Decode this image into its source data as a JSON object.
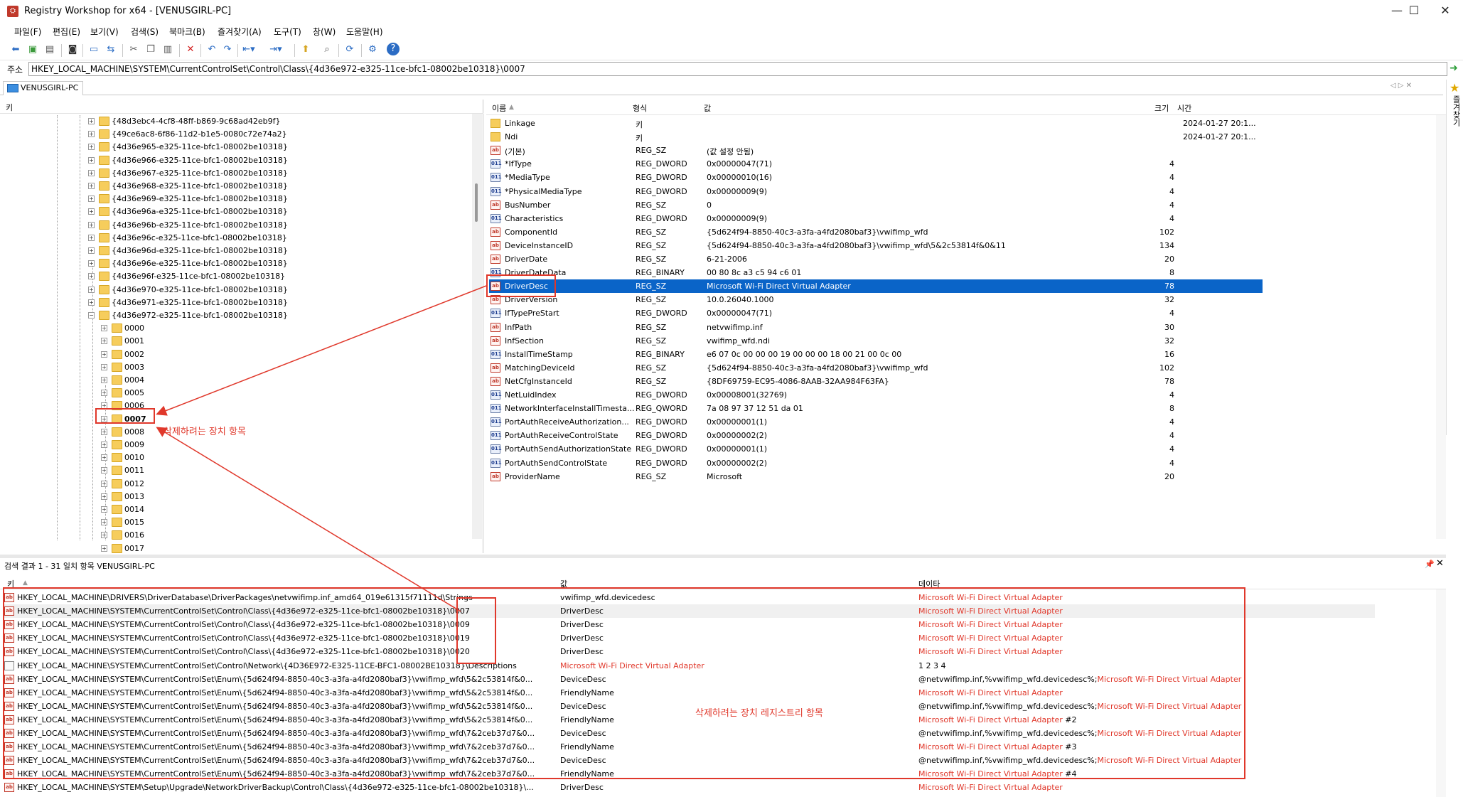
{
  "window": {
    "title": "Registry Workshop for x64 - [VENUSGIRL-PC]",
    "controls": [
      "—",
      "☐",
      "✕"
    ]
  },
  "menu": [
    "파일(F)",
    "편집(E)",
    "보기(V)",
    "검색(S)",
    "북마크(B)",
    "즐겨찾기(A)",
    "도구(T)",
    "창(W)",
    "도움말(H)"
  ],
  "address": {
    "label": "주소",
    "value": "HKEY_LOCAL_MACHINE\\SYSTEM\\CurrentControlSet\\Control\\Class\\{4d36e972-e325-11ce-bfc1-08002be10318}\\0007"
  },
  "computer_tab": "VENUSGIRL-PC",
  "favorites_label": "즐겨찾기",
  "tree": {
    "header": "키",
    "class_keys": [
      "{48d3ebc4-4cf8-48ff-b869-9c68ad42eb9f}",
      "{49ce6ac8-6f86-11d2-b1e5-0080c72e74a2}",
      "{4d36e965-e325-11ce-bfc1-08002be10318}",
      "{4d36e966-e325-11ce-bfc1-08002be10318}",
      "{4d36e967-e325-11ce-bfc1-08002be10318}",
      "{4d36e968-e325-11ce-bfc1-08002be10318}",
      "{4d36e969-e325-11ce-bfc1-08002be10318}",
      "{4d36e96a-e325-11ce-bfc1-08002be10318}",
      "{4d36e96b-e325-11ce-bfc1-08002be10318}",
      "{4d36e96c-e325-11ce-bfc1-08002be10318}",
      "{4d36e96d-e325-11ce-bfc1-08002be10318}",
      "{4d36e96e-e325-11ce-bfc1-08002be10318}",
      "{4d36e96f-e325-11ce-bfc1-08002be10318}",
      "{4d36e970-e325-11ce-bfc1-08002be10318}",
      "{4d36e971-e325-11ce-bfc1-08002be10318}",
      "{4d36e972-e325-11ce-bfc1-08002be10318}"
    ],
    "sub_keys": [
      "0000",
      "0001",
      "0002",
      "0003",
      "0004",
      "0005",
      "0006",
      "0007",
      "0008",
      "0009",
      "0010",
      "0011",
      "0012",
      "0013",
      "0014",
      "0015",
      "0016",
      "0017"
    ],
    "selected_sub_key": "0007"
  },
  "values": {
    "headers": {
      "name": "이름",
      "type": "형식",
      "value": "값",
      "size": "크기",
      "time": "시간"
    },
    "rows": [
      {
        "icon": "folder",
        "name": "Linkage",
        "type": "키",
        "value": "",
        "size": "",
        "time": "2024-01-27 20:1..."
      },
      {
        "icon": "folder",
        "name": "Ndi",
        "type": "키",
        "value": "",
        "size": "",
        "time": "2024-01-27 20:1..."
      },
      {
        "icon": "sz",
        "name": "(기본)",
        "type": "REG_SZ",
        "value": "(값 설정 안됨)",
        "size": "",
        "time": ""
      },
      {
        "icon": "bin",
        "name": "*IfType",
        "type": "REG_DWORD",
        "value": "0x00000047(71)",
        "size": "4",
        "time": ""
      },
      {
        "icon": "bin",
        "name": "*MediaType",
        "type": "REG_DWORD",
        "value": "0x00000010(16)",
        "size": "4",
        "time": ""
      },
      {
        "icon": "bin",
        "name": "*PhysicalMediaType",
        "type": "REG_DWORD",
        "value": "0x00000009(9)",
        "size": "4",
        "time": ""
      },
      {
        "icon": "sz",
        "name": "BusNumber",
        "type": "REG_SZ",
        "value": "0",
        "size": "4",
        "time": ""
      },
      {
        "icon": "bin",
        "name": "Characteristics",
        "type": "REG_DWORD",
        "value": "0x00000009(9)",
        "size": "4",
        "time": ""
      },
      {
        "icon": "sz",
        "name": "ComponentId",
        "type": "REG_SZ",
        "value": "{5d624f94-8850-40c3-a3fa-a4fd2080baf3}\\vwifimp_wfd",
        "size": "102",
        "time": ""
      },
      {
        "icon": "sz",
        "name": "DeviceInstanceID",
        "type": "REG_SZ",
        "value": "{5d624f94-8850-40c3-a3fa-a4fd2080baf3}\\vwifimp_wfd\\5&2c53814f&0&11",
        "size": "134",
        "time": ""
      },
      {
        "icon": "sz",
        "name": "DriverDate",
        "type": "REG_SZ",
        "value": "6-21-2006",
        "size": "20",
        "time": ""
      },
      {
        "icon": "bin",
        "name": "DriverDateData",
        "type": "REG_BINARY",
        "value": "00 80 8c a3 c5 94 c6 01",
        "size": "8",
        "time": ""
      },
      {
        "icon": "sz",
        "name": "DriverDesc",
        "type": "REG_SZ",
        "value": "Microsoft Wi-Fi Direct Virtual Adapter",
        "size": "78",
        "time": "",
        "selected": true
      },
      {
        "icon": "sz",
        "name": "DriverVersion",
        "type": "REG_SZ",
        "value": "10.0.26040.1000",
        "size": "32",
        "time": ""
      },
      {
        "icon": "bin",
        "name": "IfTypePreStart",
        "type": "REG_DWORD",
        "value": "0x00000047(71)",
        "size": "4",
        "time": ""
      },
      {
        "icon": "sz",
        "name": "InfPath",
        "type": "REG_SZ",
        "value": "netvwifimp.inf",
        "size": "30",
        "time": ""
      },
      {
        "icon": "sz",
        "name": "InfSection",
        "type": "REG_SZ",
        "value": "vwifimp_wfd.ndi",
        "size": "32",
        "time": ""
      },
      {
        "icon": "bin",
        "name": "InstallTimeStamp",
        "type": "REG_BINARY",
        "value": "e6 07 0c 00 00 00 19 00 00 00 18 00 21 00 0c 00",
        "size": "16",
        "time": ""
      },
      {
        "icon": "sz",
        "name": "MatchingDeviceId",
        "type": "REG_SZ",
        "value": "{5d624f94-8850-40c3-a3fa-a4fd2080baf3}\\vwifimp_wfd",
        "size": "102",
        "time": ""
      },
      {
        "icon": "sz",
        "name": "NetCfgInstanceId",
        "type": "REG_SZ",
        "value": "{8DF69759-EC95-4086-8AAB-32AA984F63FA}",
        "size": "78",
        "time": ""
      },
      {
        "icon": "bin",
        "name": "NetLuidIndex",
        "type": "REG_DWORD",
        "value": "0x00008001(32769)",
        "size": "4",
        "time": ""
      },
      {
        "icon": "bin",
        "name": "NetworkInterfaceInstallTimesta...",
        "type": "REG_QWORD",
        "value": "7a 08 97 37 12 51 da 01",
        "size": "8",
        "time": ""
      },
      {
        "icon": "bin",
        "name": "PortAuthReceiveAuthorization...",
        "type": "REG_DWORD",
        "value": "0x00000001(1)",
        "size": "4",
        "time": ""
      },
      {
        "icon": "bin",
        "name": "PortAuthReceiveControlState",
        "type": "REG_DWORD",
        "value": "0x00000002(2)",
        "size": "4",
        "time": ""
      },
      {
        "icon": "bin",
        "name": "PortAuthSendAuthorizationState",
        "type": "REG_DWORD",
        "value": "0x00000001(1)",
        "size": "4",
        "time": ""
      },
      {
        "icon": "bin",
        "name": "PortAuthSendControlState",
        "type": "REG_DWORD",
        "value": "0x00000002(2)",
        "size": "4",
        "time": ""
      },
      {
        "icon": "sz",
        "name": "ProviderName",
        "type": "REG_SZ",
        "value": "Microsoft",
        "size": "20",
        "time": ""
      }
    ]
  },
  "search": {
    "title": "검색 결과 1 - 31 일치 항목 VENUSGIRL-PC",
    "pin": "📌",
    "close": "✕",
    "headers": {
      "key": "키",
      "value": "값",
      "data": "데이타"
    },
    "rows": [
      {
        "key": "HKEY_LOCAL_MACHINE\\DRIVERS\\DriverDatabase\\DriverPackages\\netvwifimp.inf_amd64_019e61315f71111d\\Strings",
        "value": "vwifimp_wfd.devicedesc",
        "value_red": false,
        "data": "",
        "data_red": "Microsoft Wi-Fi Direct Virtual Adapter",
        "data_tail": ""
      },
      {
        "key": "HKEY_LOCAL_MACHINE\\SYSTEM\\CurrentControlSet\\Control\\Class\\{4d36e972-e325-11ce-bfc1-08002be10318}\\0007",
        "value": "DriverDesc",
        "value_red": false,
        "data": "",
        "data_red": "Microsoft Wi-Fi Direct Virtual Adapter",
        "data_tail": "",
        "hl": true
      },
      {
        "key": "HKEY_LOCAL_MACHINE\\SYSTEM\\CurrentControlSet\\Control\\Class\\{4d36e972-e325-11ce-bfc1-08002be10318}\\0009",
        "value": "DriverDesc",
        "value_red": false,
        "data": "",
        "data_red": "Microsoft Wi-Fi Direct Virtual Adapter",
        "data_tail": ""
      },
      {
        "key": "HKEY_LOCAL_MACHINE\\SYSTEM\\CurrentControlSet\\Control\\Class\\{4d36e972-e325-11ce-bfc1-08002be10318}\\0019",
        "value": "DriverDesc",
        "value_red": false,
        "data": "",
        "data_red": "Microsoft Wi-Fi Direct Virtual Adapter",
        "data_tail": ""
      },
      {
        "key": "HKEY_LOCAL_MACHINE\\SYSTEM\\CurrentControlSet\\Control\\Class\\{4d36e972-e325-11ce-bfc1-08002be10318}\\0020",
        "value": "DriverDesc",
        "value_red": false,
        "data": "",
        "data_red": "Microsoft Wi-Fi Direct Virtual Adapter",
        "data_tail": ""
      },
      {
        "key": "HKEY_LOCAL_MACHINE\\SYSTEM\\CurrentControlSet\\Control\\Network\\{4D36E972-E325-11CE-BFC1-08002BE10318}\\Descriptions",
        "value": "Microsoft Wi-Fi Direct Virtual Adapter",
        "value_red": true,
        "data": "1 2 3 4",
        "data_red": "",
        "data_tail": "",
        "keyicon": true
      },
      {
        "key": "HKEY_LOCAL_MACHINE\\SYSTEM\\CurrentControlSet\\Enum\\{5d624f94-8850-40c3-a3fa-a4fd2080baf3}\\vwifimp_wfd\\5&2c53814f&0...",
        "value": "DeviceDesc",
        "value_red": false,
        "data": "@netvwifimp.inf,%vwifimp_wfd.devicedesc%;",
        "data_red": "Microsoft Wi-Fi Direct Virtual Adapter",
        "data_tail": ""
      },
      {
        "key": "HKEY_LOCAL_MACHINE\\SYSTEM\\CurrentControlSet\\Enum\\{5d624f94-8850-40c3-a3fa-a4fd2080baf3}\\vwifimp_wfd\\5&2c53814f&0...",
        "value": "FriendlyName",
        "value_red": false,
        "data": "",
        "data_red": "Microsoft Wi-Fi Direct Virtual Adapter",
        "data_tail": ""
      },
      {
        "key": "HKEY_LOCAL_MACHINE\\SYSTEM\\CurrentControlSet\\Enum\\{5d624f94-8850-40c3-a3fa-a4fd2080baf3}\\vwifimp_wfd\\5&2c53814f&0...",
        "value": "DeviceDesc",
        "value_red": false,
        "data": "@netvwifimp.inf,%vwifimp_wfd.devicedesc%;",
        "data_red": "Microsoft Wi-Fi Direct Virtual Adapter",
        "data_tail": ""
      },
      {
        "key": "HKEY_LOCAL_MACHINE\\SYSTEM\\CurrentControlSet\\Enum\\{5d624f94-8850-40c3-a3fa-a4fd2080baf3}\\vwifimp_wfd\\5&2c53814f&0...",
        "value": "FriendlyName",
        "value_red": false,
        "data": "",
        "data_red": "Microsoft Wi-Fi Direct Virtual Adapter",
        "data_tail": " #2"
      },
      {
        "key": "HKEY_LOCAL_MACHINE\\SYSTEM\\CurrentControlSet\\Enum\\{5d624f94-8850-40c3-a3fa-a4fd2080baf3}\\vwifimp_wfd\\7&2ceb37d7&0...",
        "value": "DeviceDesc",
        "value_red": false,
        "data": "@netvwifimp.inf,%vwifimp_wfd.devicedesc%;",
        "data_red": "Microsoft Wi-Fi Direct Virtual Adapter",
        "data_tail": ""
      },
      {
        "key": "HKEY_LOCAL_MACHINE\\SYSTEM\\CurrentControlSet\\Enum\\{5d624f94-8850-40c3-a3fa-a4fd2080baf3}\\vwifimp_wfd\\7&2ceb37d7&0...",
        "value": "FriendlyName",
        "value_red": false,
        "data": "",
        "data_red": "Microsoft Wi-Fi Direct Virtual Adapter",
        "data_tail": " #3"
      },
      {
        "key": "HKEY_LOCAL_MACHINE\\SYSTEM\\CurrentControlSet\\Enum\\{5d624f94-8850-40c3-a3fa-a4fd2080baf3}\\vwifimp_wfd\\7&2ceb37d7&0...",
        "value": "DeviceDesc",
        "value_red": false,
        "data": "@netvwifimp.inf,%vwifimp_wfd.devicedesc%;",
        "data_red": "Microsoft Wi-Fi Direct Virtual Adapter",
        "data_tail": ""
      },
      {
        "key": "HKEY_LOCAL_MACHINE\\SYSTEM\\CurrentControlSet\\Enum\\{5d624f94-8850-40c3-a3fa-a4fd2080baf3}\\vwifimp_wfd\\7&2ceb37d7&0...",
        "value": "FriendlyName",
        "value_red": false,
        "data": "",
        "data_red": "Microsoft Wi-Fi Direct Virtual Adapter",
        "data_tail": " #4"
      },
      {
        "key": "HKEY_LOCAL_MACHINE\\SYSTEM\\Setup\\Upgrade\\NetworkDriverBackup\\Control\\Class\\{4d36e972-e325-11ce-bfc1-08002be10318}\\...",
        "value": "DriverDesc",
        "value_red": false,
        "data": "",
        "data_red": "Microsoft Wi-Fi Direct Virtual Adapter",
        "data_tail": ""
      }
    ]
  },
  "annotations": {
    "device_item": "삭제하려는 장치 항목",
    "registry_items": "삭제하려는 장치 레지스트리 항목",
    "color": "#e0382b"
  },
  "toolbar_icons": [
    "back-icon",
    "forward-icon",
    "save-icon",
    "export-icon",
    "computer-icon",
    "connect-icon",
    "cut-icon",
    "copy-icon",
    "paste-icon",
    "delete-icon",
    "undo-icon",
    "redo-icon",
    "nav-back-icon",
    "nav-forward-icon",
    "folder-up-icon",
    "find-icon",
    "refresh-icon",
    "options-icon",
    "help-icon"
  ]
}
